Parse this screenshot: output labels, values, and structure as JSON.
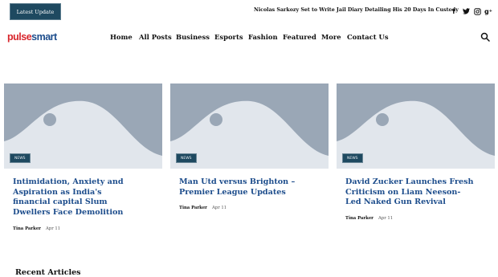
{
  "topbar": {
    "latest_label": "Latest Update",
    "ticker": "Nicolas Sarkozy Set to Write Jail Diary Detailing His 20 Days In Custody",
    "social_icons": [
      "facebook-icon",
      "twitter-icon",
      "instagram-icon",
      "google-plus-icon"
    ]
  },
  "logo": {
    "part1": "pulse",
    "part2": "smart"
  },
  "nav": {
    "items": [
      "Home",
      "All Posts",
      "Business",
      "Esports",
      "Fashion",
      "Featured",
      "More",
      "Contact Us"
    ]
  },
  "colors": {
    "brand_red": "#d8262c",
    "brand_blue": "#1d4d8c",
    "badge_bg": "#1e4960",
    "placeholder": "#9aa7b6"
  },
  "cards": [
    {
      "badge": "NEWS",
      "title": "Intimidation, Anxiety and Aspiration as India's financial capital Slum Dwellers Face Demolition",
      "author": "Tina Parker",
      "date": "Apr 11"
    },
    {
      "badge": "NEWS",
      "title": "Man Utd versus Brighton – Premier League Updates",
      "author": "Tina Parker",
      "date": "Apr 11"
    },
    {
      "badge": "NEWS",
      "title": "David Zucker Launches Fresh Criticism on Liam Neeson-Led Naked Gun Revival",
      "author": "Tina Parker",
      "date": "Apr 11"
    }
  ],
  "recent": {
    "title": "Recent Articles"
  }
}
